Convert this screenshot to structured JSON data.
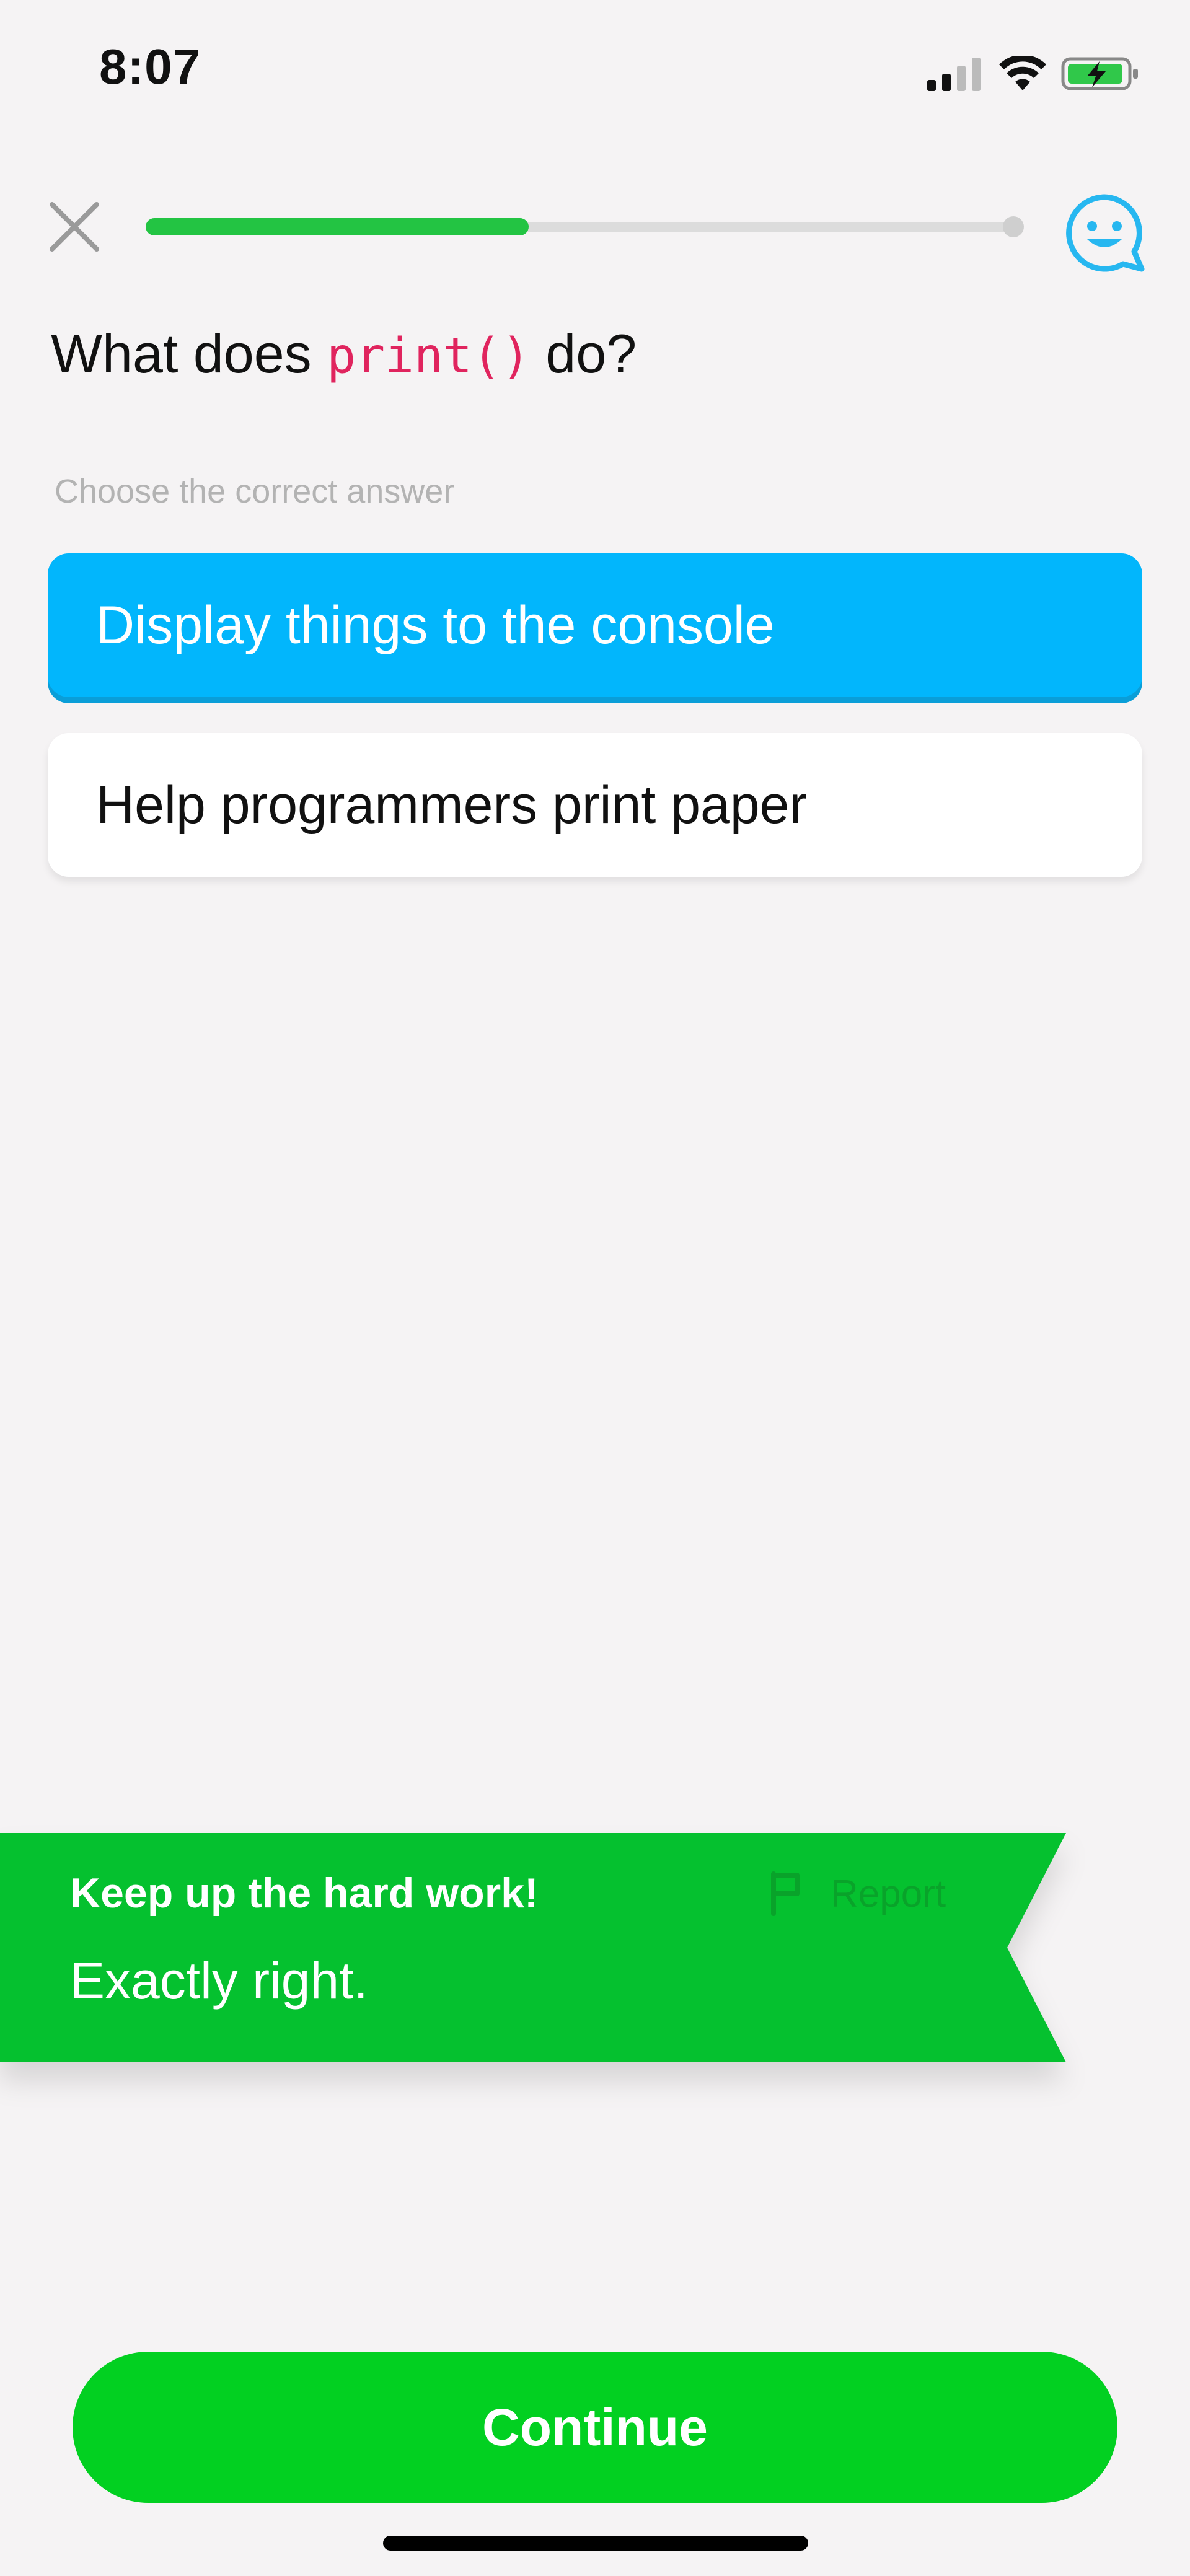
{
  "status_bar": {
    "time": "8:07",
    "icons": [
      "cellular-signal-icon",
      "wifi-icon",
      "battery-charging-icon"
    ]
  },
  "header": {
    "close_icon": "close-icon",
    "progress_percent": 0.44,
    "help_icon": "smiley-chat-icon"
  },
  "question": {
    "prefix": "What does ",
    "code": "print()",
    "suffix": " do?"
  },
  "instruction": "Choose the correct answer",
  "answers": [
    {
      "label": "Display things to the console",
      "selected": true
    },
    {
      "label": "Help programmers print paper",
      "selected": false
    }
  ],
  "feedback": {
    "title": "Keep up the hard work!",
    "message": "Exactly right.",
    "report_label": "Report",
    "report_icon": "flag-icon"
  },
  "continue_label": "Continue",
  "colors": {
    "accent_green": "#05c12f",
    "selected_blue": "#02b6fc",
    "code_pink": "#e0245e"
  }
}
